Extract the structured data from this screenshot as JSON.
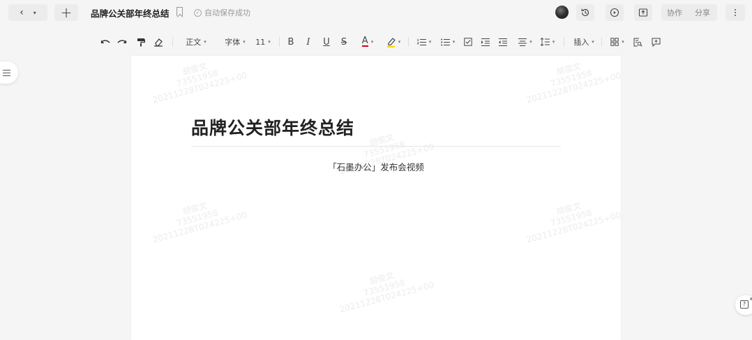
{
  "topbar": {
    "doc_title": "品牌公关部年终总结",
    "autosave_text": "自动保存成功",
    "collab_label": "协作",
    "share_label": "分享"
  },
  "toolbar": {
    "style_label": "正文",
    "font_label": "字体",
    "size_label": "11",
    "bold": "B",
    "italic": "I",
    "underline": "U",
    "strike": "S",
    "font_color": "A",
    "insert_label": "插入"
  },
  "document": {
    "heading": "品牌公关部年终总结",
    "subtitle": "「石墨办公」发布会视频"
  },
  "watermark": {
    "name": "胡俊文",
    "id": "73551958",
    "stamp": "20211228T024225+00"
  },
  "icons": {
    "back": "chevron-left-icon",
    "new": "plus-icon",
    "bookmark": "bookmark-icon",
    "history": "history-icon",
    "present": "play-icon",
    "export": "export-icon",
    "more": "more-icon",
    "outline": "outline-menu-icon",
    "help": "help-icon"
  },
  "colors": {
    "font_color_underline": "#d0021b",
    "highlight_underline": "#f5d800"
  }
}
